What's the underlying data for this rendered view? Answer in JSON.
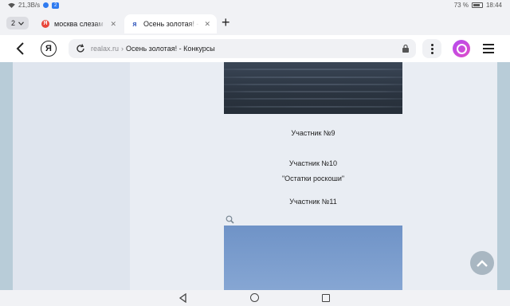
{
  "status_bar": {
    "speed": "21,3B/s",
    "notification_count": "2",
    "battery": "73 %",
    "time": "18:44"
  },
  "tabs": {
    "count": "2",
    "items": [
      {
        "label": "москва слезам не верит",
        "icon": "yandex-red-icon",
        "active": false
      },
      {
        "label": "Осень золотая! - Конкурсы",
        "icon": "yandex-blue-icon",
        "active": true
      }
    ]
  },
  "nav": {
    "logo": "Я",
    "domain": "realax.ru",
    "separator": "›",
    "title": "Осень золотая! - Конкурсы"
  },
  "content": {
    "captions": [
      "Участник №9",
      "Участник №10",
      "\"Остатки роскоши\"",
      "Участник №11"
    ]
  },
  "colors": {
    "page_side": "#b8ccd8",
    "left_column": "#dfe5ee",
    "main_column": "#e9edf3",
    "alice_accent": "#c94ce0"
  }
}
